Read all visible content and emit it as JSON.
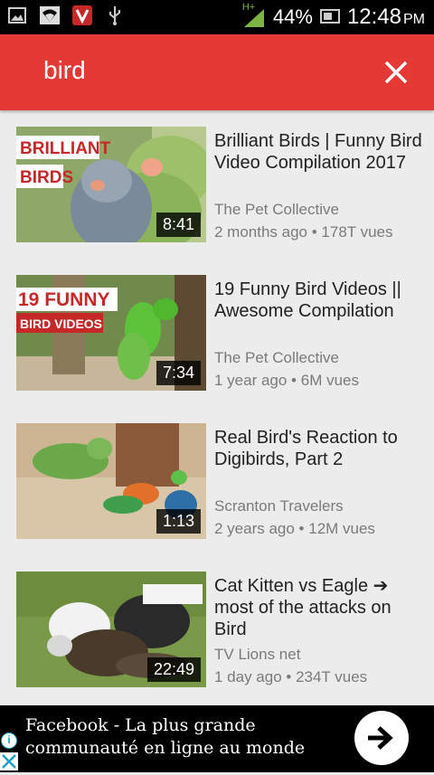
{
  "status_bar": {
    "network_type": "H+",
    "battery_percent": "44%",
    "time": "12:48",
    "ampm": "PM"
  },
  "search": {
    "query": "bird"
  },
  "results": [
    {
      "thumbnail_text_1": "BRILLIANT",
      "thumbnail_text_2": "BIRDS",
      "duration": "8:41",
      "title": "Brilliant Birds | Funny Bird Video Compilation 2017",
      "channel": "The Pet Collective",
      "meta": "2 months ago • 178T vues"
    },
    {
      "thumbnail_text_1": "19 FUNNY",
      "thumbnail_text_2": "BIRD VIDEOS",
      "duration": "7:34",
      "title": "19 Funny Bird Videos || Awesome Compilation",
      "channel": "The Pet Collective",
      "meta": "1 year ago • 6M vues"
    },
    {
      "duration": "1:13",
      "title": "Real Bird's Reaction to Digibirds, Part 2",
      "channel": "Scranton Travelers",
      "meta": "2 years ago • 12M vues"
    },
    {
      "duration": "22:49",
      "title": "Cat Kitten vs Eagle ➔ most of the attacks on Bird",
      "channel": "TV Lions net",
      "meta": "1 day ago • 234T vues"
    }
  ],
  "ad": {
    "text": "Facebook - La plus grande communauté en ligne au monde"
  },
  "colors": {
    "accent": "#e53935",
    "background": "#ececec"
  }
}
